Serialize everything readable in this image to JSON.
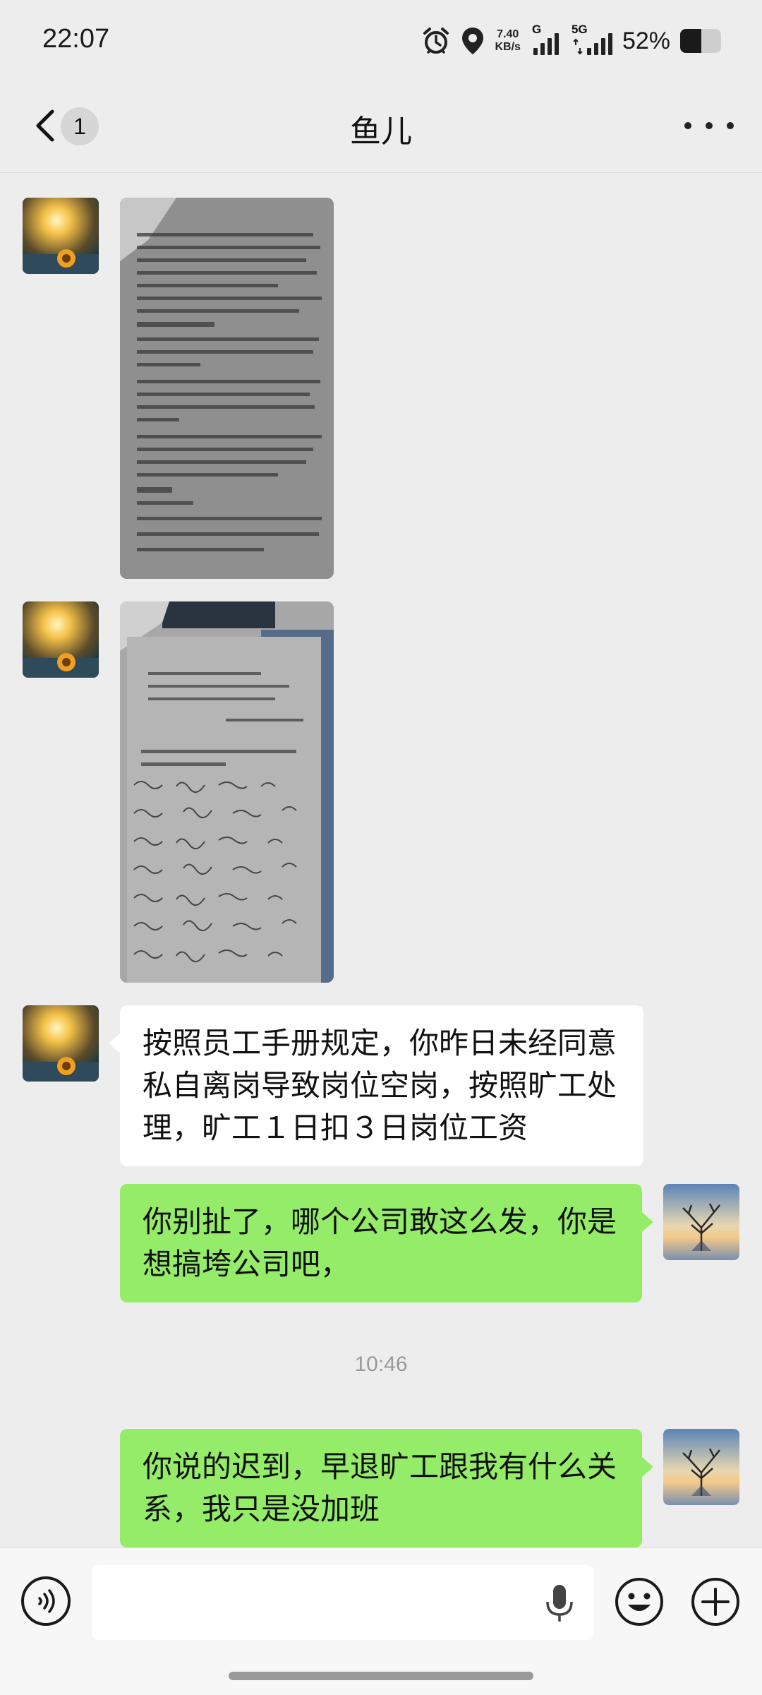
{
  "status_bar": {
    "time": "22:07",
    "net_speed_value": "7.40",
    "net_speed_unit": "KB/s",
    "sim1_tag": "G",
    "sim2_tag": "5G",
    "battery_percent": "52%",
    "battery_level": 0.52,
    "icons": [
      "alarm-icon",
      "location-icon"
    ]
  },
  "nav": {
    "unread_count": "1",
    "title": "鱼儿",
    "more_icon": "more-dots-icon"
  },
  "messages": [
    {
      "side": "left",
      "type": "image",
      "content": "photo of employee handbook page (absenteeism rules)"
    },
    {
      "side": "left",
      "type": "image",
      "content": "photo of handbook acknowledgement page with signatures"
    },
    {
      "side": "left",
      "type": "text",
      "text": "按照员工手册规定，你昨日未经同意私自离岗导致岗位空岗，按照旷工处理，旷工１日扣３日岗位工资"
    },
    {
      "side": "right",
      "type": "text",
      "text": "你别扯了，哪个公司敢这么发，你是想搞垮公司吧，"
    },
    {
      "type": "timestamp",
      "text": "10:46"
    },
    {
      "side": "right",
      "type": "text",
      "text": "你说的迟到，早退旷工跟我有什么关系，我只是没加班"
    }
  ],
  "input_bar": {
    "voice_icon": "voice-toggle-icon",
    "mic_icon": "microphone-icon",
    "emoji_icon": "emoji-icon",
    "plus_icon": "plus-icon"
  },
  "colors": {
    "background": "#ededed",
    "bubble_self": "#95ec69",
    "bubble_other": "#ffffff"
  }
}
